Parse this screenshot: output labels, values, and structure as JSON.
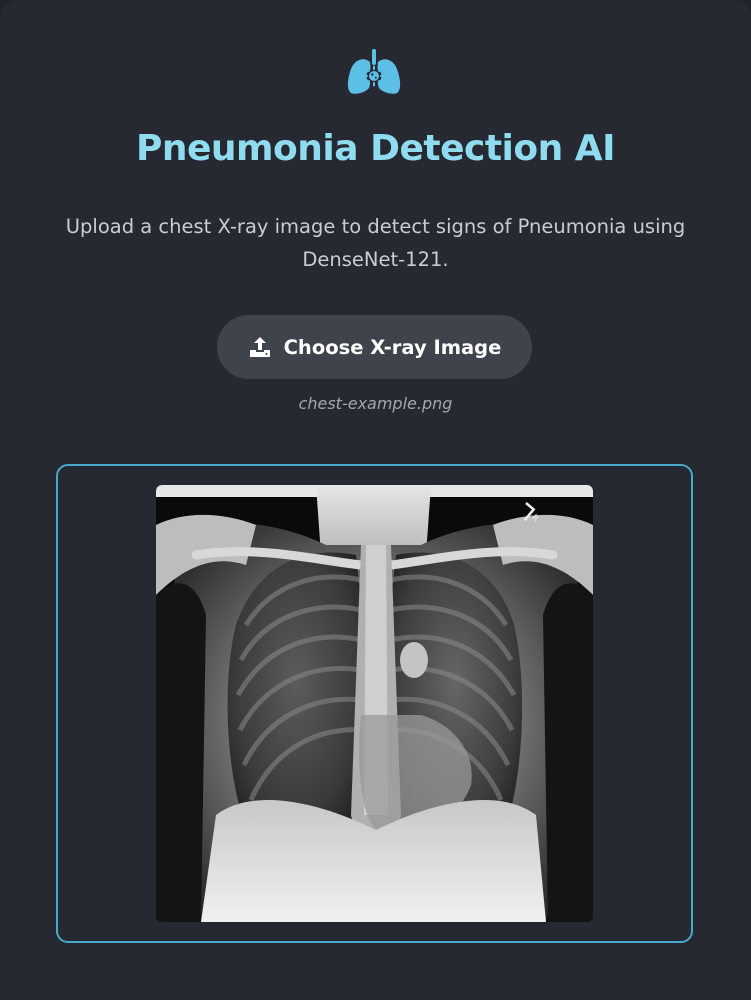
{
  "app": {
    "logo_icon": "lungs-virus-icon",
    "title": "Pneumonia Detection AI",
    "subtitle": "Upload a chest X-ray image to detect signs of Pneumonia using DenseNet-121.",
    "accent_color": "#8fdcf0",
    "border_color": "#4aa9c9"
  },
  "upload": {
    "button_icon": "upload-icon",
    "button_label": "Choose X-ray Image",
    "selected_file": "chest-example.png"
  },
  "preview": {
    "image_label": "chest X-ray preview",
    "corner_marker": "R"
  }
}
